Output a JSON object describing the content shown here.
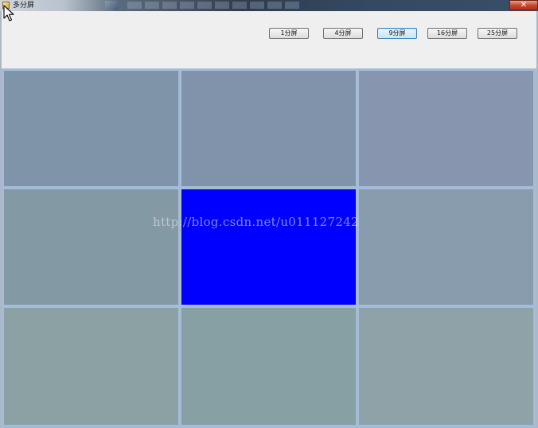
{
  "window": {
    "title": "多分屏",
    "close_glyph": "✕"
  },
  "toolbar": {
    "buttons": [
      {
        "label": "1分屏",
        "active": false
      },
      {
        "label": "4分屏",
        "active": false
      },
      {
        "label": "9分屏",
        "active": true
      },
      {
        "label": "16分屏",
        "active": false
      },
      {
        "label": "25分屏",
        "active": false
      }
    ]
  },
  "grid": {
    "rows": 3,
    "cols": 3,
    "cell_colors": [
      "#7f94a8",
      "#8093aa",
      "#8796ae",
      "#8399a4",
      "#0000ff",
      "#889cae",
      "#8ca1a4",
      "#87a0a3",
      "#8ea2a8"
    ],
    "selected_index": 4,
    "divider_color": "#a4bcd8"
  },
  "watermark": "http://blog.csdn.net/u011127242",
  "icons": {
    "app": "window-app-icon",
    "cursor": "mouse-pointer-icon"
  }
}
